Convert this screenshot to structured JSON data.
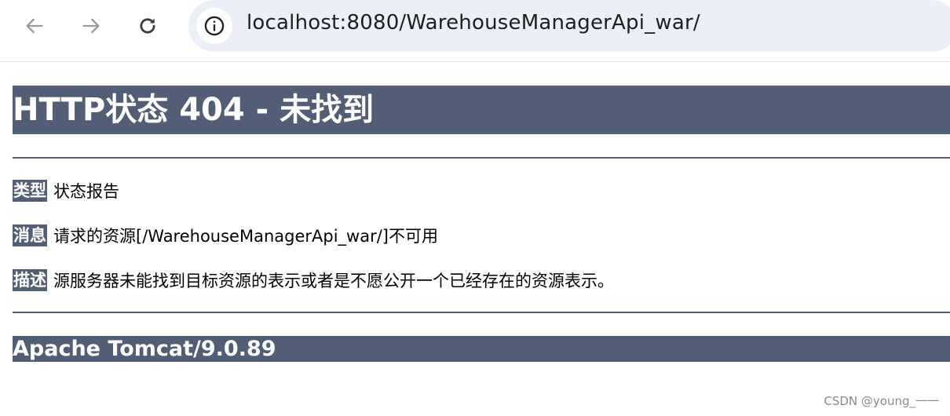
{
  "browser": {
    "url": "localhost:8080/WarehouseManagerApi_war/",
    "icons": {
      "back": "arrow-left-icon",
      "forward": "arrow-right-icon",
      "reload": "reload-icon",
      "site_info": "info-icon"
    }
  },
  "error_page": {
    "title": "HTTP状态 404 - 未找到",
    "rows": [
      {
        "label": "类型",
        "value": "状态报告"
      },
      {
        "label": "消息",
        "value": "请求的资源[/WarehouseManagerApi_war/]不可用"
      },
      {
        "label": "描述",
        "value": "源服务器未能找到目标资源的表示或者是不愿公开一个已经存在的资源表示。"
      }
    ],
    "server": "Apache Tomcat/9.0.89"
  },
  "watermark": "CSDN @young_一一",
  "colors": {
    "banner": "#525d76",
    "omnibox": "#edeff8"
  }
}
